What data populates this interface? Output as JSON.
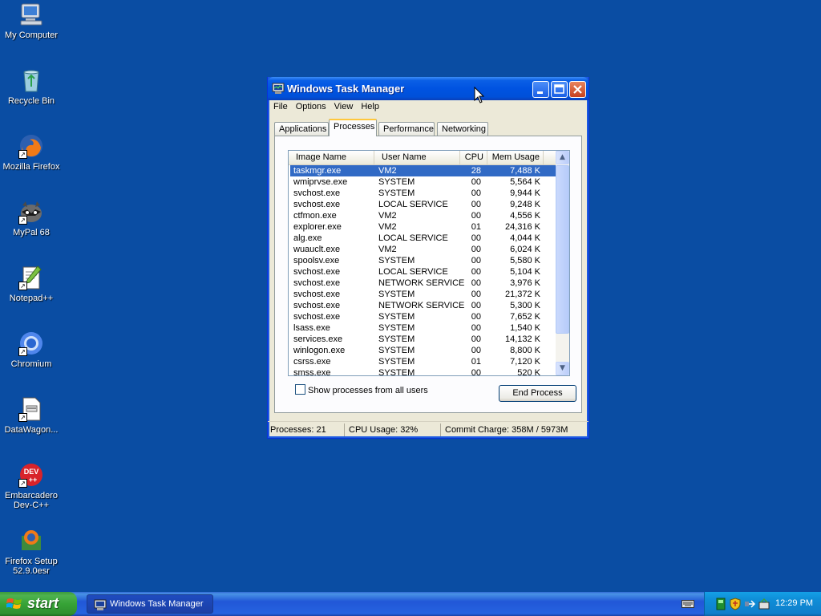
{
  "desktop": {
    "icons": [
      {
        "label": "My Computer"
      },
      {
        "label": "Recycle Bin"
      },
      {
        "label": "Mozilla Firefox"
      },
      {
        "label": "MyPal 68"
      },
      {
        "label": "Notepad++"
      },
      {
        "label": "Chromium"
      },
      {
        "label": "DataWagon..."
      },
      {
        "label": "Embarcadero Dev-C++"
      },
      {
        "label": "Firefox Setup 52.9.0esr"
      }
    ]
  },
  "window": {
    "title": "Windows Task Manager",
    "menu": [
      "File",
      "Options",
      "View",
      "Help"
    ],
    "tabs": [
      "Applications",
      "Processes",
      "Performance",
      "Networking"
    ],
    "active_tab": "Processes",
    "columns": [
      "Image Name",
      "User Name",
      "CPU",
      "Mem Usage"
    ],
    "processes": [
      {
        "image": "taskmgr.exe",
        "user": "VM2",
        "cpu": "28",
        "mem": "7,488 K"
      },
      {
        "image": "wmiprvse.exe",
        "user": "SYSTEM",
        "cpu": "00",
        "mem": "5,564 K"
      },
      {
        "image": "svchost.exe",
        "user": "SYSTEM",
        "cpu": "00",
        "mem": "9,944 K"
      },
      {
        "image": "svchost.exe",
        "user": "LOCAL SERVICE",
        "cpu": "00",
        "mem": "9,248 K"
      },
      {
        "image": "ctfmon.exe",
        "user": "VM2",
        "cpu": "00",
        "mem": "4,556 K"
      },
      {
        "image": "explorer.exe",
        "user": "VM2",
        "cpu": "01",
        "mem": "24,316 K"
      },
      {
        "image": "alg.exe",
        "user": "LOCAL SERVICE",
        "cpu": "00",
        "mem": "4,044 K"
      },
      {
        "image": "wuauclt.exe",
        "user": "VM2",
        "cpu": "00",
        "mem": "6,024 K"
      },
      {
        "image": "spoolsv.exe",
        "user": "SYSTEM",
        "cpu": "00",
        "mem": "5,580 K"
      },
      {
        "image": "svchost.exe",
        "user": "LOCAL SERVICE",
        "cpu": "00",
        "mem": "5,104 K"
      },
      {
        "image": "svchost.exe",
        "user": "NETWORK SERVICE",
        "cpu": "00",
        "mem": "3,976 K"
      },
      {
        "image": "svchost.exe",
        "user": "SYSTEM",
        "cpu": "00",
        "mem": "21,372 K"
      },
      {
        "image": "svchost.exe",
        "user": "NETWORK SERVICE",
        "cpu": "00",
        "mem": "5,300 K"
      },
      {
        "image": "svchost.exe",
        "user": "SYSTEM",
        "cpu": "00",
        "mem": "7,652 K"
      },
      {
        "image": "lsass.exe",
        "user": "SYSTEM",
        "cpu": "00",
        "mem": "1,540 K"
      },
      {
        "image": "services.exe",
        "user": "SYSTEM",
        "cpu": "00",
        "mem": "14,132 K"
      },
      {
        "image": "winlogon.exe",
        "user": "SYSTEM",
        "cpu": "00",
        "mem": "8,800 K"
      },
      {
        "image": "csrss.exe",
        "user": "SYSTEM",
        "cpu": "01",
        "mem": "7,120 K"
      },
      {
        "image": "smss.exe",
        "user": "SYSTEM",
        "cpu": "00",
        "mem": "520 K"
      }
    ],
    "show_all_label": "Show processes from all users",
    "end_process_label": "End Process",
    "status": {
      "processes": "Processes: 21",
      "cpu": "CPU Usage: 32%",
      "commit": "Commit Charge: 358M / 5973M"
    }
  },
  "taskbar": {
    "start_label": "start",
    "task_item": "Windows Task Manager",
    "clock": "12:29 PM"
  },
  "colors": {
    "desktop": "#0a4da3",
    "selection": "#316ac5",
    "titlebar": "#0053e1"
  }
}
